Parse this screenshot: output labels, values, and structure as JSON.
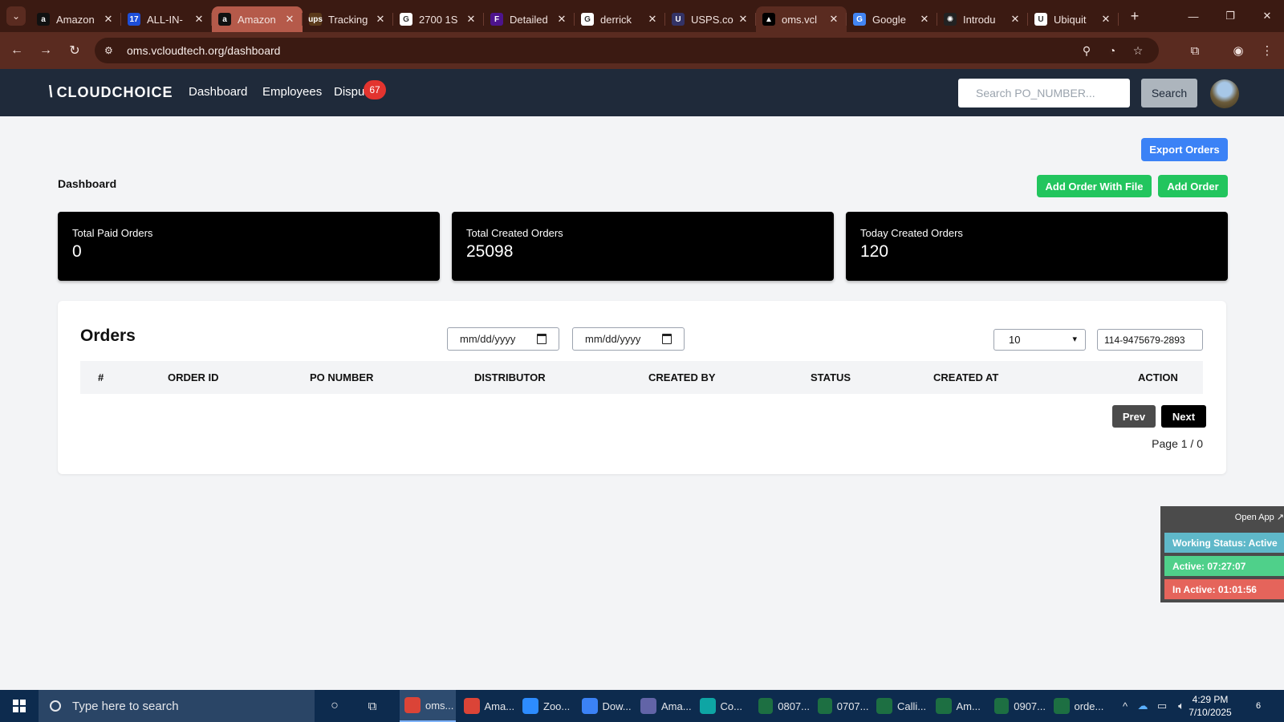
{
  "browser": {
    "tabs": [
      {
        "title": "Amazon",
        "icon": "amazon-icon",
        "favicon_text": "a",
        "color": "#111111"
      },
      {
        "title": "ALL-IN-",
        "icon": "17track-icon",
        "favicon_text": "17",
        "color": "#1d4ed8"
      },
      {
        "title": "Amazon",
        "icon": "amazon-icon",
        "favicon_text": "a",
        "color": "#111111"
      },
      {
        "title": "Tracking",
        "icon": "ups-icon",
        "favicon_text": "ups",
        "color": "#5b3a1a"
      },
      {
        "title": "2700 1S",
        "icon": "google-icon",
        "favicon_text": "G",
        "color": "#ffffff"
      },
      {
        "title": "Detailed",
        "icon": "fedex-icon",
        "favicon_text": "F",
        "color": "#4d148c"
      },
      {
        "title": "derrick",
        "icon": "google-icon",
        "favicon_text": "G",
        "color": "#ffffff"
      },
      {
        "title": "USPS.co",
        "icon": "usps-icon",
        "favicon_text": "U",
        "color": "#333366"
      },
      {
        "title": "oms.vcl",
        "icon": "oms-icon",
        "favicon_text": "▲",
        "color": "#000000"
      },
      {
        "title": "Google",
        "icon": "google-translate-icon",
        "favicon_text": "G",
        "color": "#4285f4"
      },
      {
        "title": "Introdu",
        "icon": "openai-icon",
        "favicon_text": "✺",
        "color": "#222222"
      },
      {
        "title": "Ubiquit",
        "icon": "ubiquiti-icon",
        "favicon_text": "U",
        "color": "#ffffff"
      }
    ],
    "url": "oms.vcloudtech.org/dashboard"
  },
  "navbar": {
    "logo": "CLOUDCHOICE",
    "links": [
      "Dashboard",
      "Employees",
      "Dispu"
    ],
    "dispute_badge": "67",
    "search_placeholder": "Search PO_NUMBER...",
    "search_button": "Search"
  },
  "actions": {
    "export": "Export Orders",
    "add_with_file": "Add Order With File",
    "add_order": "Add Order"
  },
  "page_title": "Dashboard",
  "stats": [
    {
      "label": "Total Paid Orders",
      "value": "0"
    },
    {
      "label": "Total Created Orders",
      "value": "25098"
    },
    {
      "label": "Today Created Orders",
      "value": "120"
    }
  ],
  "orders": {
    "title": "Orders",
    "date_placeholder_1": "mm/dd/yyyy",
    "date_placeholder_2": "mm/dd/yyyy",
    "page_size": "10",
    "filter_value": "114-9475679-2893",
    "columns": [
      "#",
      "ORDER ID",
      "PO NUMBER",
      "DISTRIBUTOR",
      "CREATED BY",
      "STATUS",
      "CREATED AT",
      "ACTION"
    ],
    "rows": [],
    "prev": "Prev",
    "next": "Next",
    "page_info": "Page 1 / 0"
  },
  "status_widget": {
    "open_app": "Open App ↗",
    "working_status": "Working Status: Active",
    "active": "Active: 07:27:07",
    "inactive": "In Active: 01:01:56"
  },
  "taskbar": {
    "search_placeholder": "Type here to search",
    "apps": [
      {
        "label": "oms...",
        "icon": "chrome-icon",
        "color": "#db4437"
      },
      {
        "label": "Ama...",
        "icon": "chrome-icon",
        "color": "#db4437"
      },
      {
        "label": "Zoo...",
        "icon": "zoom-icon",
        "color": "#2d8cff"
      },
      {
        "label": "Dow...",
        "icon": "download-icon",
        "color": "#3b82f6"
      },
      {
        "label": "Ama...",
        "icon": "teams-icon",
        "color": "#6264a7"
      },
      {
        "label": "Co...",
        "icon": "copilot-icon",
        "color": "#0ea5a4"
      },
      {
        "label": "0807...",
        "icon": "excel-icon",
        "color": "#1d6f42"
      },
      {
        "label": "0707...",
        "icon": "excel-icon",
        "color": "#1d6f42"
      },
      {
        "label": "Calli...",
        "icon": "excel-icon",
        "color": "#1d6f42"
      },
      {
        "label": "Am...",
        "icon": "excel-icon",
        "color": "#1d6f42"
      },
      {
        "label": "0907...",
        "icon": "excel-icon",
        "color": "#1d6f42"
      },
      {
        "label": "orde...",
        "icon": "excel-icon",
        "color": "#1d6f42"
      }
    ],
    "time": "4:29 PM",
    "date": "7/10/2025",
    "notifications": "6"
  },
  "colors": {
    "navbar_bg": "#1f2a3a",
    "export_blue": "#3b82f6",
    "add_green": "#22c55e",
    "status_working": "#5fb8c9",
    "status_active": "#4fd08a",
    "status_inactive": "#e5645b"
  }
}
